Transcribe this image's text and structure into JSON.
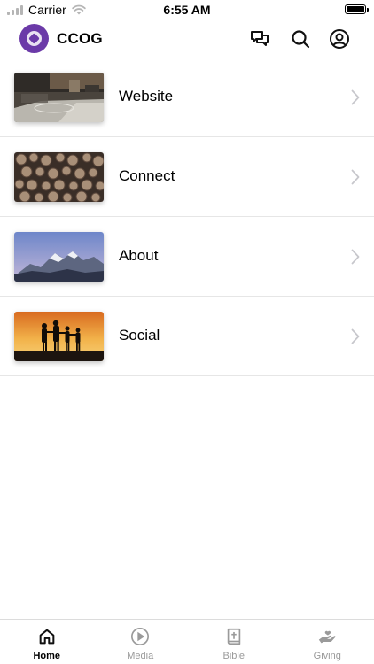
{
  "status_bar": {
    "carrier": "Carrier",
    "time": "6:55 AM",
    "icons": [
      "signal-icon",
      "wifi-icon",
      "battery-icon"
    ]
  },
  "header": {
    "title": "CCOG",
    "logo_color": "#6b3aa8",
    "icons": [
      "chat-icon",
      "search-icon",
      "profile-icon"
    ]
  },
  "menu": {
    "items": [
      {
        "label": "Website",
        "thumbnail": "living-room-photo"
      },
      {
        "label": "Connect",
        "thumbnail": "log-pile-photo"
      },
      {
        "label": "About",
        "thumbnail": "mountain-photo"
      },
      {
        "label": "Social",
        "thumbnail": "sunset-family-photo"
      }
    ]
  },
  "tabs": [
    {
      "label": "Home",
      "icon": "home-icon",
      "active": true
    },
    {
      "label": "Media",
      "icon": "play-circle-icon",
      "active": false
    },
    {
      "label": "Bible",
      "icon": "bible-icon",
      "active": false
    },
    {
      "label": "Giving",
      "icon": "giving-hand-icon",
      "active": false
    }
  ],
  "colors": {
    "accent": "#6b3aa8",
    "active_tab": "#000000",
    "inactive_tab": "#9a9a9a",
    "divider": "#e6e6e6"
  }
}
